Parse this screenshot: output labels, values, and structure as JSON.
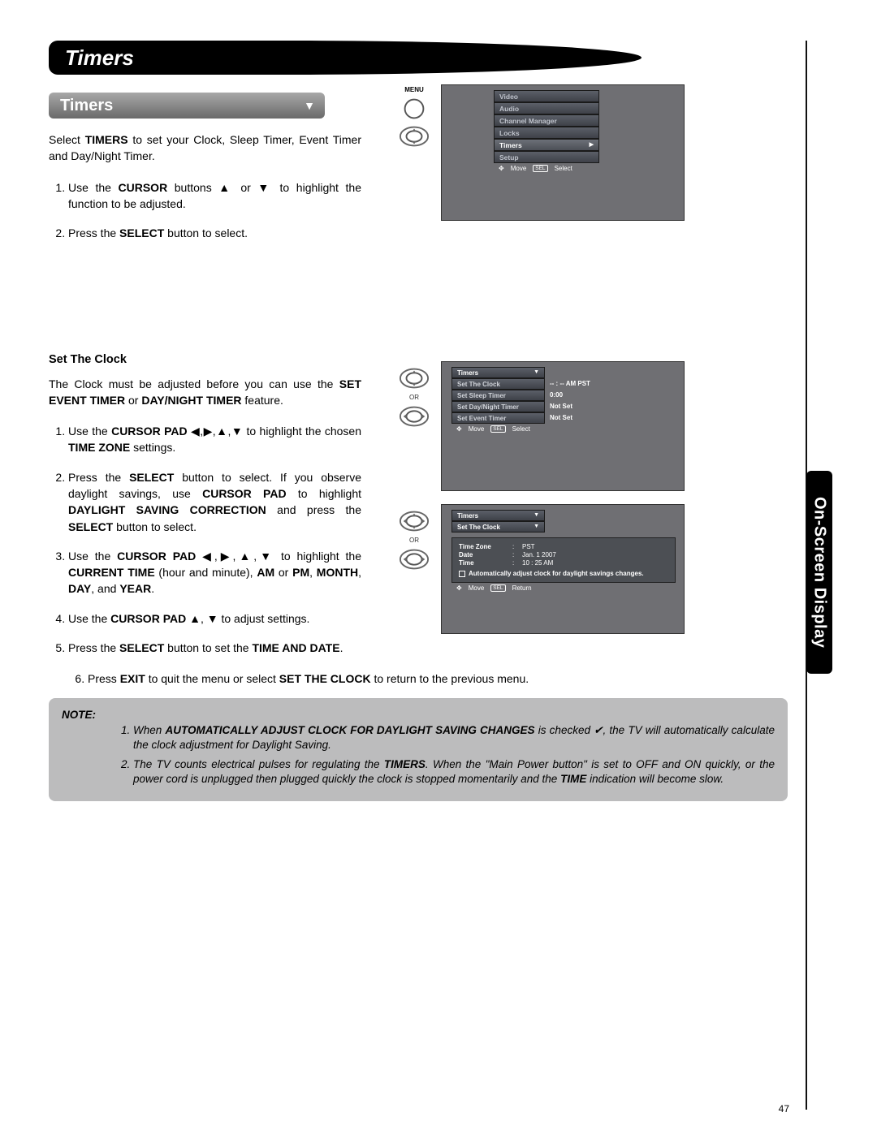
{
  "page_number": "47",
  "side_tab": "On-Screen Display",
  "header": "Timers",
  "subheader": "Timers",
  "intro": {
    "pre": "Select ",
    "b1": "TIMERS",
    "post": " to set your Clock, Sleep Timer, Event Timer and Day/Night Timer."
  },
  "steps1": {
    "s1_a": "Use the ",
    "s1_b": "CURSOR",
    "s1_c": " buttons ▲ or ▼ to highlight the function to be adjusted.",
    "s2_a": "Press the ",
    "s2_b": "SELECT",
    "s2_c": " button to select."
  },
  "clock": {
    "title": "Set The Clock",
    "intro_a": "The Clock must be adjusted before you can use the ",
    "intro_b": "SET EVENT TIMER",
    "intro_c": " or ",
    "intro_d": "DAY/NIGHT TIMER",
    "intro_e": " feature.",
    "s1_a": "Use the ",
    "s1_b": "CURSOR PAD",
    "s1_c": " ◀,▶,▲,▼ to highlight the chosen ",
    "s1_d": "TIME ZONE",
    "s1_e": " settings.",
    "s2_a": "Press the ",
    "s2_b": "SELECT",
    "s2_c": " button to select. If you observe daylight savings, use ",
    "s2_d": "CURSOR PAD",
    "s2_e": " to highlight ",
    "s2_f": "DAYLIGHT SAVING CORRECTION",
    "s2_g": " and press the ",
    "s2_h": "SELECT",
    "s2_i": " button to select.",
    "s3_a": "Use the ",
    "s3_b": "CURSOR PAD",
    "s3_c": " ◀,▶,▲,▼ to highlight the ",
    "s3_d": "CURRENT TIME",
    "s3_e": " (hour and minute), ",
    "s3_f": "AM",
    "s3_g": " or ",
    "s3_h": "PM",
    "s3_i": ", ",
    "s3_j": "MONTH",
    "s3_k": ", ",
    "s3_l": "DAY",
    "s3_m": ", and ",
    "s3_n": "YEAR",
    "s3_o": ".",
    "s4_a": "Use the ",
    "s4_b": "CURSOR PAD",
    "s4_c": " ▲, ▼ to adjust settings.",
    "s5_a": "Press the ",
    "s5_b": "SELECT",
    "s5_c": " button to set the ",
    "s5_d": "TIME AND DATE",
    "s5_e": ".",
    "s6_a": "Press ",
    "s6_b": "EXIT",
    "s6_c": " to quit the menu or select ",
    "s6_d": "SET THE CLOCK",
    "s6_e": " to return to the previous menu."
  },
  "note": {
    "label": "NOTE:",
    "n1_a": "When ",
    "n1_b": "AUTOMATICALLY ADJUST CLOCK FOR DAYLIGHT SAVING CHANGES",
    "n1_c": " is checked ✔, the TV will automatically calculate the clock adjustment for Daylight Saving.",
    "n2_a": "The TV counts electrical pulses for regulating the ",
    "n2_b": "TIMERS",
    "n2_c": ". When the \"Main Power button\" is set to OFF and ON quickly, or the power cord is unplugged then plugged quickly the clock is stopped momentarily and the ",
    "n2_d": "TIME",
    "n2_e": " indication will become slow."
  },
  "tv1": {
    "menu_label": "MENU",
    "items": [
      "Video",
      "Audio",
      "Channel Manager",
      "Locks",
      "Timers",
      "Setup"
    ],
    "hint_move": "Move",
    "hint_sel": "SEL",
    "hint_select": "Select"
  },
  "tv2": {
    "title": "Timers",
    "rows": [
      {
        "l": "Set The Clock",
        "r": "-- : -- AM PST"
      },
      {
        "l": "Set Sleep Timer",
        "r": "0:00"
      },
      {
        "l": "Set Day/Night Timer",
        "r": "Not Set"
      },
      {
        "l": "Set Event Timer",
        "r": "Not Set"
      }
    ],
    "hint_move": "Move",
    "hint_sel": "SEL",
    "hint_select": "Select"
  },
  "tv3": {
    "title": "Timers",
    "sub": "Set The Clock",
    "tz_k": "Time Zone",
    "tz_v": "PST",
    "date_k": "Date",
    "date_v": "Jan. 1 2007",
    "time_k": "Time",
    "time_v": "10 : 25 AM",
    "auto": "Automatically adjust clock for daylight savings changes.",
    "hint_move": "Move",
    "hint_sel": "SEL",
    "hint_return": "Return"
  },
  "remote": {
    "or": "OR"
  }
}
